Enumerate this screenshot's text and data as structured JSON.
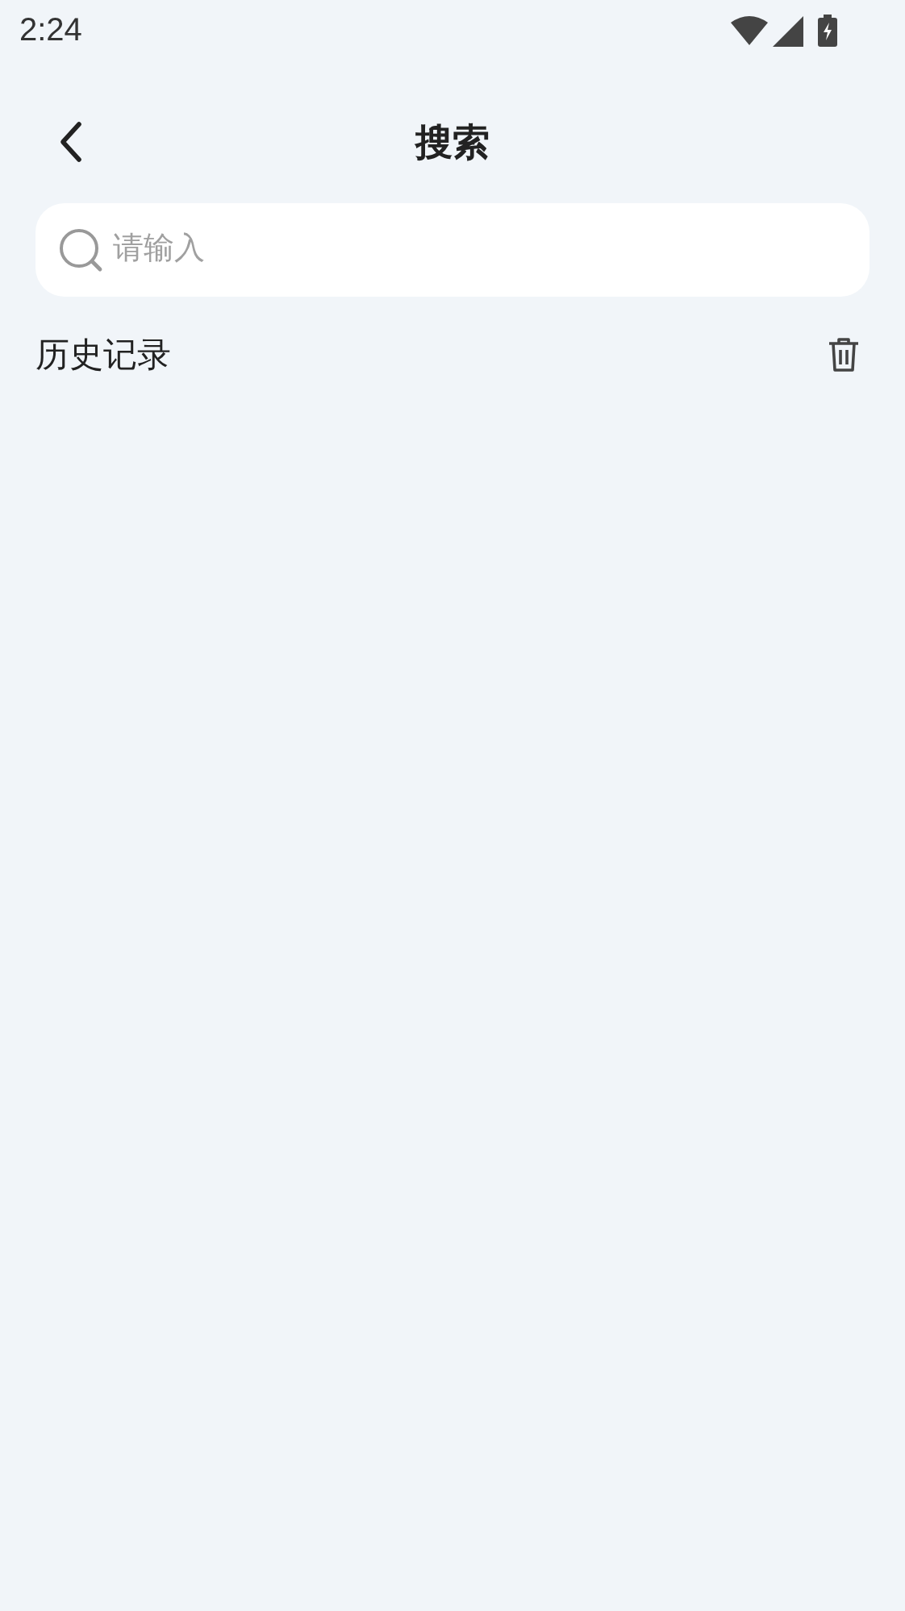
{
  "status_bar": {
    "time": "2:24"
  },
  "header": {
    "title": "搜索"
  },
  "search": {
    "placeholder": "请输入"
  },
  "history": {
    "title": "历史记录"
  }
}
